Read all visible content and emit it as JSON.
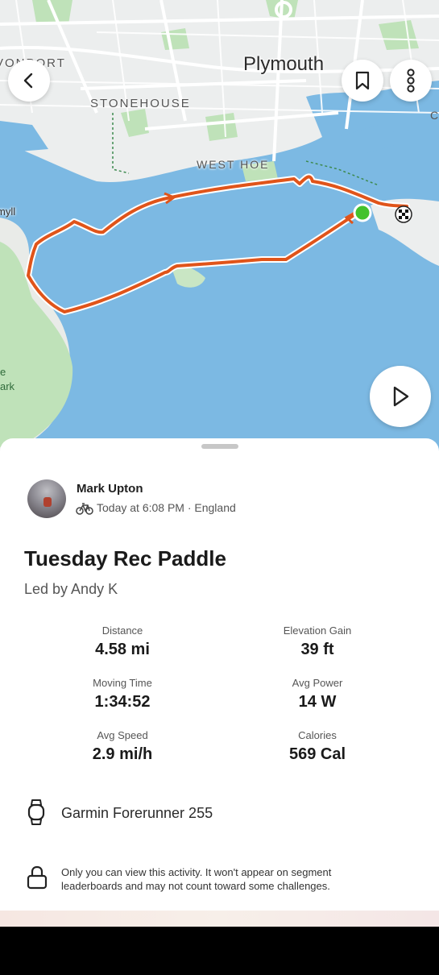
{
  "map": {
    "labels": {
      "plymouth": "Plymouth",
      "stonehouse": "STONEHOUSE",
      "west_hoe": "WEST HOE",
      "devonport": "VONPORT",
      "mount": "myll",
      "park_line1": "e",
      "park_line2": "ark",
      "edge_c": "C"
    },
    "colors": {
      "water": "#7cb9e3",
      "land": "#eceeee",
      "park": "#bfe2b9",
      "route": "#e0541a",
      "start": "#43c22c"
    },
    "buttons": [
      "back-icon",
      "bookmark-icon",
      "more-vertical-icon",
      "play-icon"
    ]
  },
  "activity": {
    "athlete": "Mark Upton",
    "sport_icon": "bike-icon",
    "meta": "Today at 6:08 PM · England",
    "title": "Tuesday Rec Paddle",
    "description": "Led by Andy K",
    "stats": [
      {
        "label": "Distance",
        "value": "4.58 mi"
      },
      {
        "label": "Elevation Gain",
        "value": "39 ft"
      },
      {
        "label": "Moving Time",
        "value": "1:34:52"
      },
      {
        "label": "Avg Power",
        "value": "14 W"
      },
      {
        "label": "Avg Speed",
        "value": "2.9 mi/h"
      },
      {
        "label": "Calories",
        "value": "569 Cal"
      }
    ],
    "device": "Garmin Forerunner 255",
    "privacy": "Only you can view this activity. It won't appear on segment leaderboards and may not count toward some challenges."
  }
}
